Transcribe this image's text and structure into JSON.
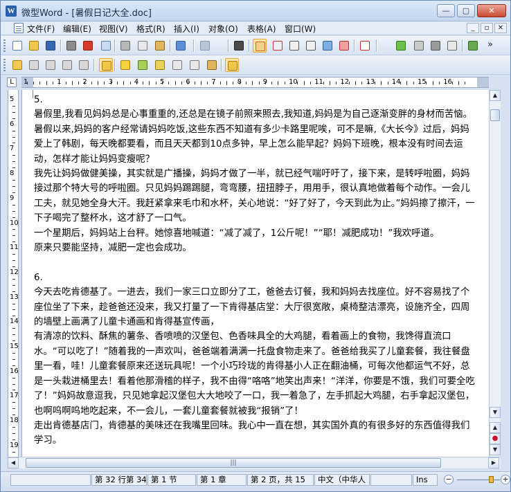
{
  "window": {
    "title": "微型Word - [暑假日记大全.doc]",
    "app_icon": "W",
    "controls": {
      "minimize": "—",
      "maximize": "▢",
      "close": "✕"
    }
  },
  "menu": {
    "items": [
      "文件(F)",
      "编辑(E)",
      "视图(V)",
      "格式(R)",
      "插入(I)",
      "对象(O)",
      "表格(A)",
      "窗口(W)"
    ],
    "mdi_controls": [
      "_",
      "▫",
      "✕"
    ]
  },
  "toolbar1": {
    "icons": [
      {
        "name": "new-document-icon",
        "color": "#ffffff",
        "border": "#5a7fb8"
      },
      {
        "name": "open-folder-icon",
        "color": "#f2c649",
        "border": "#a57c10"
      },
      {
        "name": "save-icon",
        "color": "#3767b3",
        "border": "#20467f"
      },
      {
        "name": "print-icon",
        "color": "#8c8c8c",
        "border": "#4d4d4d"
      },
      {
        "name": "pdf-export-icon",
        "color": "#d63a2a",
        "border": "#8c1f14"
      },
      {
        "name": "print-preview-icon",
        "color": "#c9d9ee",
        "border": "#5a7fb8"
      },
      {
        "name": "cut-icon",
        "color": "#b8b8b8",
        "border": "#666666"
      },
      {
        "name": "copy-icon",
        "color": "#e8e8e8",
        "border": "#7a7a7a"
      },
      {
        "name": "paste-icon",
        "color": "#e0b560",
        "border": "#8a6520"
      },
      {
        "name": "undo-icon",
        "color": "#5a8fd6",
        "border": "#2d5ea3"
      },
      {
        "name": "redo-icon",
        "color": "#b7c5d8",
        "border": "#8797ad"
      },
      {
        "name": "find-icon",
        "color": "#4a4a4a",
        "border": "#222222"
      },
      {
        "name": "page-view-icon",
        "color": "#f4d28a",
        "border": "#c9641a"
      },
      {
        "name": "line-view-icon",
        "color": "#f0f0f0",
        "border": "#c63232"
      },
      {
        "name": "outline-view-icon",
        "color": "#f0f0f0",
        "border": "#555555"
      },
      {
        "name": "web-view-icon",
        "color": "#f0f0f0",
        "border": "#555555"
      },
      {
        "name": "zoom-icon",
        "color": "#7eb0e6",
        "border": "#2d5ea3"
      },
      {
        "name": "percent-icon",
        "color": "#f2a0a0",
        "border": "#b33030"
      },
      {
        "name": "font-icon",
        "color": "#ffffff",
        "border": "#c62828"
      },
      {
        "name": "spellcheck-icon",
        "color": "#6cc04a",
        "border": "#2e7d12"
      },
      {
        "name": "columns-icon",
        "color": "#c9c9c9",
        "border": "#666666"
      },
      {
        "name": "frame-icon",
        "color": "#9a9a9a",
        "border": "#555555"
      },
      {
        "name": "letter-l-icon",
        "color": "#e8e8e8",
        "border": "#666666"
      },
      {
        "name": "binoculars-icon",
        "color": "#6aa84f",
        "border": "#2f6b1e"
      }
    ],
    "overflow": "»"
  },
  "toolbar2": {
    "icons": [
      {
        "name": "format-brush-icon",
        "color": "#f3c94f",
        "border": "#a57c10"
      },
      {
        "name": "highlight-icon",
        "color": "#d8d8d8",
        "border": "#777777"
      },
      {
        "name": "clear-format-icon",
        "color": "#d8d8d8",
        "border": "#777777"
      },
      {
        "name": "insert-object-icon",
        "color": "#d8d8d8",
        "border": "#777777"
      },
      {
        "name": "copy-format-icon",
        "color": "#d8d8d8",
        "border": "#777777"
      },
      {
        "name": "paste-format-icon",
        "color": "#f2c649",
        "border": "#a57c10"
      },
      {
        "name": "star-pen-icon",
        "color": "#f6d13c",
        "border": "#a57c10"
      },
      {
        "name": "pen-green-icon",
        "color": "#a7d15a",
        "border": "#4c7d16"
      },
      {
        "name": "pen-yellow-icon",
        "color": "#e9d25c",
        "border": "#8d7a12"
      },
      {
        "name": "pen-outline-icon",
        "color": "#e8e8e8",
        "border": "#777777"
      },
      {
        "name": "pen-outline-2-icon",
        "color": "#e8e8e8",
        "border": "#777777"
      },
      {
        "name": "edit-note-icon",
        "color": "#e0b560",
        "border": "#8a6520"
      },
      {
        "name": "track-changes-icon",
        "color": "#f2c649",
        "border": "#a57c10"
      }
    ]
  },
  "ruler": {
    "tab_marker": "L",
    "numbers": [
      "2",
      "1",
      "1",
      "2",
      "3",
      "4",
      "5",
      "6",
      "7",
      "8",
      "9",
      "10",
      "11",
      "12",
      "13",
      "14",
      "15",
      "16"
    ]
  },
  "vruler": {
    "numbers": [
      "5",
      "6",
      "7",
      "8",
      "9",
      "10",
      "11",
      "12",
      "13",
      "14",
      "15",
      "16",
      "17",
      "18",
      "19"
    ]
  },
  "document": {
    "paragraphs": [
      "5.",
      "暑假里,我看见妈妈总是心事重重的,还总是在镜子前照来照去,我知道,妈妈是为自己逐渐变胖的身材而苦恼。暑假以来,妈妈的客户经常请妈妈吃饭,这些东西不知道有多少卡路里呢唉，可不是嘛,《大长今》过后，妈妈爱上了韩剧，每天晚都要看，而且天天都到10点多钟，早上怎么能早起？妈妈下班晚，根本没有时间去运动，怎样才能让妈妈变瘦呢？",
      "我先让妈妈做健美操，其实就是广播操，妈妈才做了一半，就已经气喘吁吁了，接下来，是转呼啦圈，妈妈接过那个特大号的呼啦圈。只见妈妈踢踢腿，弯弯腰，扭扭脖子，用用手，很认真地做着每个动作。一会儿工夫，就见她全身大汗。我赶紧拿来毛巾和水杯，关心地说：“好了好了，今天到此为止。”妈妈擦了擦汗，一下子喝完了整杯水，这才舒了一口气。",
      "一个星期后，妈妈站上台秤。她惊喜地喊道：“减了减了，1公斤呢！”“耶！减肥成功！”我欢呼道。",
      "原来只要能坚持，减肥一定也会成功。",
      "",
      "6.",
      "今天去吃肯德基了。一进去，我们一家三口立即分了工，爸爸去订餐，我和妈妈去找座位。好不容易找了个座位坐了下来，趁爸爸还没来，我又打量了一下肯得基店堂：大厅很宽敞，桌椅整洁漂亮，设施齐全，四周的墙壁上画满了儿童卡通画和肯得基宣传画，",
      "有清凉的饮料、酥焦的薯条、香喷喷的汉堡包、色香味具全的大鸡腿，看着画上的食物，我馋得直流口水。“可以吃了！”随着我的一声欢叫，爸爸端着满满一托盘食物走来了。爸爸给我买了儿童套餐，我往餐盘里一看，哇！儿童套餐原来还送玩具呢！一个小巧玲珑的肯得基小人正在翻油桶，可每次他都运气不好，总是一头栽进桶里去！看着他那滑稽的样子，我不由得“咯咯”地笑出声来！“洋洋，你要是不饿，我们可要全吃了！”妈妈故意逗我，只见她拿起汉堡包大大地咬了一口，我一着急了，左手抓起大鸡腿，右手拿起汉堡包，也啊呜啊呜地吃起来，不一会儿，一套儿童套餐就被我“报销”了！",
      "走出肯德基店门，肯德基的美味还在我嘴里回味。我心中一直在想，其实国外真的有很多好的东西值得我们学习。"
    ]
  },
  "scrollbar": {
    "up": "▲",
    "down": "▼",
    "page_up": "▲",
    "page_down": "▼",
    "grip": "|||"
  },
  "status": {
    "position": "第 32 行第 34",
    "section": "第 1 节",
    "chapter": "第 1 章",
    "pages": "第 2 页，共 15",
    "language": "中文（中华人",
    "mode": "Ins",
    "zoom_out": "−",
    "zoom_in": "+"
  }
}
